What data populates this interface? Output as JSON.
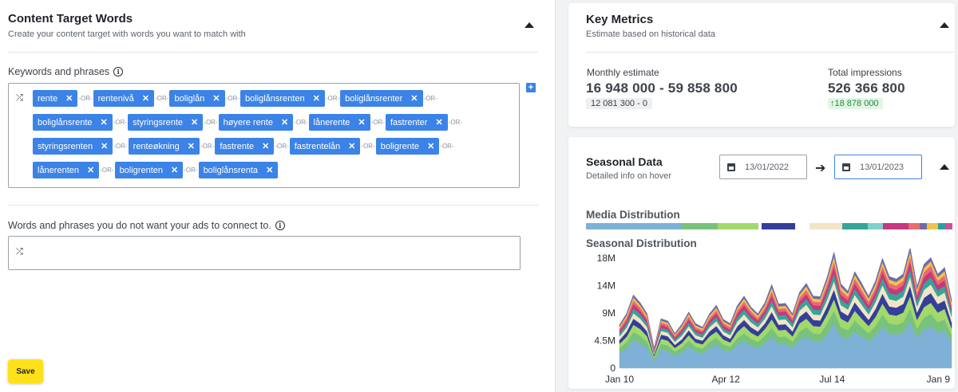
{
  "left": {
    "title": "Content Target Words",
    "subtitle": "Create your content target with words you want to match with",
    "keywords_label": "Keywords and phrases",
    "negative_label": "Words and phrases you do not want your ads to connect to.",
    "or_text": "OR",
    "remove_glyph": "✕",
    "keyword_rows": [
      [
        "rente",
        "rentenivå",
        "boliglån",
        "boliglånsrenten",
        "boliglånsrenter"
      ],
      [
        "boliglånsrente",
        "styringsrente",
        "høyere rente",
        "lånerente",
        "fastrenter"
      ],
      [
        "styringsrenten",
        "renteøkning",
        "fastrente",
        "fastrentelån",
        "boligrente"
      ],
      [
        "lånerenten",
        "boligrenten",
        "boliglånsrenta"
      ]
    ],
    "save_label": "Save"
  },
  "key_metrics": {
    "title": "Key Metrics",
    "subtitle": "Estimate based on historical data",
    "monthly_label": "Monthly estimate",
    "monthly_value": "16 948 000 - 59 858 800",
    "monthly_sub": "12 081 300 - 0",
    "total_label": "Total impressions",
    "total_value": "526 366 800",
    "total_change": "18 878 000"
  },
  "seasonal": {
    "title": "Seasonal Data",
    "subtitle": "Detailed info on hover",
    "date_from": "13/01/2022",
    "date_to": "13/01/2023",
    "media_heading": "Media Distribution",
    "seasonal_heading": "Seasonal Distribution",
    "media_colors": [
      "#7fb1d6",
      "#79c27b",
      "#a3d86b",
      "#ffffff",
      "#333f9a",
      "#ffffff",
      "#f3e4c6",
      "#33a699",
      "#7fd1c9",
      "#c73780",
      "#e86b6f",
      "#6e6da8",
      "#f2c14d",
      "#2f9e9e",
      "#d04e9a"
    ],
    "media_fractions": [
      0.26,
      0.1,
      0.11,
      0.01,
      0.09,
      0.04,
      0.09,
      0.07,
      0.04,
      0.07,
      0.03,
      0.02,
      0.03,
      0.02,
      0.02
    ]
  },
  "chart_data": {
    "type": "area",
    "xlabel": "",
    "ylabel": "",
    "ylim": [
      0,
      18000000
    ],
    "y_ticks": [
      "18M",
      "14M",
      "9M",
      "4.5M",
      "0"
    ],
    "x_ticks": [
      "Jan 10",
      "Apr 12",
      "Jul 14",
      "Jan 9"
    ],
    "stacked": true,
    "series": [
      {
        "color": "#7fb1d6",
        "values": [
          2.5,
          3.2,
          4.6,
          4.1,
          3.3,
          1.2,
          3.1,
          2.8,
          2.0,
          2.6,
          3.5,
          2.7,
          2.4,
          3.3,
          3.9,
          3.0,
          2.7,
          3.8,
          4.4,
          3.7,
          3.3,
          4.1,
          5.1,
          3.9,
          4.0,
          3.3,
          4.6,
          5.2,
          4.4,
          4.3,
          5.6,
          7.3,
          5.2,
          4.8,
          6.0,
          5.2,
          4.4,
          5.3,
          6.8,
          5.6,
          5.5,
          5.8,
          7.6,
          5.0,
          6.4,
          6.9,
          5.8,
          6.2,
          4.2
        ]
      },
      {
        "color": "#79c27b",
        "values": [
          0.8,
          1.0,
          1.3,
          1.2,
          1.0,
          0.4,
          0.9,
          0.9,
          0.7,
          0.8,
          1.0,
          0.8,
          0.8,
          1.0,
          1.1,
          0.9,
          0.8,
          1.1,
          1.3,
          1.1,
          1.0,
          1.2,
          1.5,
          1.2,
          1.2,
          1.0,
          1.4,
          1.5,
          1.3,
          1.3,
          1.7,
          2.1,
          1.5,
          1.4,
          1.8,
          1.5,
          1.3,
          1.6,
          2.0,
          1.7,
          1.6,
          1.7,
          2.2,
          1.5,
          1.9,
          2.0,
          1.7,
          1.8,
          1.2
        ]
      },
      {
        "color": "#a3d86b",
        "values": [
          0.7,
          0.9,
          1.2,
          1.1,
          0.9,
          0.3,
          0.8,
          0.8,
          0.6,
          0.7,
          0.9,
          0.7,
          0.7,
          0.9,
          1.0,
          0.8,
          0.7,
          1.0,
          1.2,
          1.0,
          0.9,
          1.1,
          1.4,
          1.1,
          1.1,
          0.9,
          1.3,
          1.4,
          1.2,
          1.2,
          1.5,
          1.9,
          1.4,
          1.3,
          1.6,
          1.4,
          1.2,
          1.5,
          1.8,
          1.5,
          1.5,
          1.6,
          2.0,
          1.4,
          1.7,
          1.8,
          1.6,
          1.7,
          1.1
        ]
      },
      {
        "color": "#333f9a",
        "values": [
          0.6,
          0.8,
          1.0,
          0.9,
          0.8,
          0.3,
          0.7,
          0.7,
          0.5,
          0.6,
          0.8,
          0.6,
          0.6,
          0.8,
          0.9,
          0.7,
          0.6,
          0.9,
          1.0,
          0.9,
          0.8,
          0.9,
          1.2,
          0.9,
          0.9,
          0.8,
          1.1,
          1.2,
          1.0,
          1.0,
          1.3,
          1.6,
          1.2,
          1.1,
          1.4,
          1.2,
          1.0,
          1.3,
          1.6,
          1.3,
          1.3,
          1.4,
          1.7,
          1.2,
          1.5,
          1.6,
          1.4,
          1.4,
          1.0
        ]
      },
      {
        "color": "#f3e4c6",
        "values": [
          0.6,
          0.7,
          0.9,
          0.8,
          0.7,
          0.3,
          0.6,
          0.6,
          0.5,
          0.6,
          0.7,
          0.6,
          0.5,
          0.7,
          0.8,
          0.6,
          0.6,
          0.8,
          0.9,
          0.8,
          0.7,
          0.8,
          1.0,
          0.8,
          0.8,
          0.7,
          1.0,
          1.1,
          0.9,
          0.9,
          1.1,
          1.4,
          1.0,
          1.0,
          1.2,
          1.1,
          0.9,
          1.1,
          1.4,
          1.2,
          1.1,
          1.2,
          1.5,
          1.0,
          1.3,
          1.4,
          1.2,
          1.3,
          0.9
        ]
      },
      {
        "color": "#33a699",
        "values": [
          0.5,
          0.6,
          0.8,
          0.7,
          0.6,
          0.2,
          0.5,
          0.5,
          0.4,
          0.5,
          0.6,
          0.5,
          0.5,
          0.6,
          0.7,
          0.5,
          0.5,
          0.7,
          0.8,
          0.7,
          0.6,
          0.7,
          0.9,
          0.7,
          0.7,
          0.6,
          0.8,
          0.9,
          0.8,
          0.8,
          1.0,
          1.2,
          0.9,
          0.8,
          1.0,
          0.9,
          0.8,
          0.9,
          1.2,
          1.0,
          1.0,
          1.0,
          1.3,
          0.9,
          1.1,
          1.2,
          1.0,
          1.1,
          0.8
        ]
      },
      {
        "color": "#c73780",
        "values": [
          0.4,
          0.5,
          0.7,
          0.6,
          0.5,
          0.2,
          0.5,
          0.4,
          0.3,
          0.4,
          0.5,
          0.4,
          0.4,
          0.5,
          0.6,
          0.5,
          0.4,
          0.6,
          0.7,
          0.6,
          0.5,
          0.6,
          0.8,
          0.6,
          0.6,
          0.5,
          0.7,
          0.8,
          0.7,
          0.7,
          0.9,
          1.1,
          0.8,
          0.7,
          0.9,
          0.8,
          0.7,
          0.8,
          1.0,
          0.9,
          0.8,
          0.9,
          1.1,
          0.8,
          1.0,
          1.0,
          0.9,
          0.9,
          0.6
        ]
      },
      {
        "color": "#e86b6f",
        "values": [
          0.4,
          0.5,
          0.6,
          0.5,
          0.4,
          0.2,
          0.4,
          0.4,
          0.3,
          0.4,
          0.5,
          0.4,
          0.3,
          0.4,
          0.5,
          0.4,
          0.4,
          0.5,
          0.6,
          0.5,
          0.4,
          0.5,
          0.7,
          0.5,
          0.5,
          0.4,
          0.6,
          0.7,
          0.6,
          0.6,
          0.7,
          0.9,
          0.7,
          0.6,
          0.8,
          0.7,
          0.6,
          0.7,
          0.9,
          0.7,
          0.7,
          0.7,
          0.9,
          0.6,
          0.8,
          0.9,
          0.7,
          0.8,
          0.5
        ]
      },
      {
        "color": "#f2c14d",
        "values": [
          0.3,
          0.4,
          0.5,
          0.4,
          0.4,
          0.1,
          0.3,
          0.3,
          0.2,
          0.3,
          0.4,
          0.3,
          0.3,
          0.4,
          0.4,
          0.3,
          0.3,
          0.4,
          0.5,
          0.4,
          0.4,
          0.4,
          0.6,
          0.4,
          0.4,
          0.4,
          0.5,
          0.6,
          0.5,
          0.5,
          0.6,
          0.8,
          0.6,
          0.5,
          0.6,
          0.6,
          0.5,
          0.6,
          0.7,
          0.6,
          0.6,
          0.6,
          0.8,
          0.5,
          0.7,
          0.7,
          0.6,
          0.7,
          0.5
        ]
      },
      {
        "color": "#6e6da8",
        "values": [
          0.3,
          0.3,
          0.4,
          0.4,
          0.3,
          0.1,
          0.3,
          0.3,
          0.2,
          0.3,
          0.3,
          0.3,
          0.2,
          0.3,
          0.4,
          0.3,
          0.3,
          0.4,
          0.4,
          0.3,
          0.3,
          0.4,
          0.5,
          0.4,
          0.4,
          0.3,
          0.4,
          0.5,
          0.4,
          0.4,
          0.5,
          0.7,
          0.5,
          0.4,
          0.5,
          0.5,
          0.4,
          0.5,
          0.6,
          0.5,
          0.5,
          0.5,
          0.7,
          0.5,
          0.6,
          0.6,
          0.5,
          0.6,
          0.4
        ]
      }
    ]
  }
}
